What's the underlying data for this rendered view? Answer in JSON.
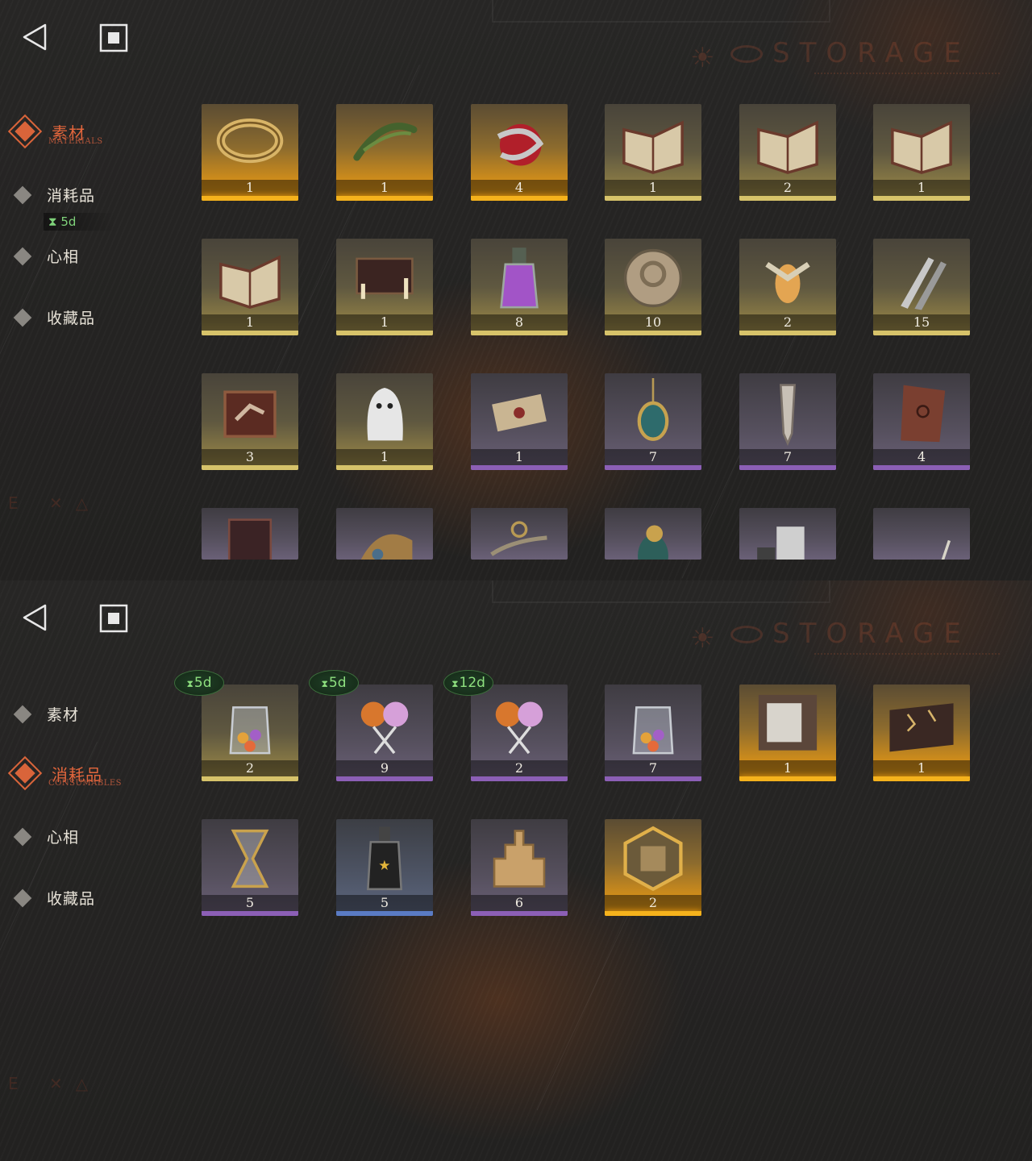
{
  "screens": [
    {
      "header": {
        "back_icon": "back-triangle-icon",
        "home_icon": "home-square-icon",
        "storage_title": "STORAGE"
      },
      "sidebar": {
        "items": [
          {
            "label": "素材",
            "sub": "MATERIALS",
            "active": true
          },
          {
            "label": "消耗品",
            "sub": "",
            "active": false,
            "timer": "5d"
          },
          {
            "label": "心相",
            "sub": "",
            "active": false
          },
          {
            "label": "收藏品",
            "sub": "",
            "active": false
          }
        ]
      },
      "items": [
        {
          "name": "gold-ring",
          "count": "1",
          "rarity": "gold"
        },
        {
          "name": "laurel-wreath",
          "count": "1",
          "rarity": "gold"
        },
        {
          "name": "snake-apple",
          "count": "4",
          "rarity": "gold"
        },
        {
          "name": "red-rune-book",
          "count": "1",
          "rarity": "yellow"
        },
        {
          "name": "green-rune-book",
          "count": "2",
          "rarity": "yellow"
        },
        {
          "name": "blue-rune-book",
          "count": "1",
          "rarity": "yellow"
        },
        {
          "name": "gold-rune-book",
          "count": "1",
          "rarity": "yellow"
        },
        {
          "name": "ouija-board",
          "count": "1",
          "rarity": "yellow"
        },
        {
          "name": "purple-potion",
          "count": "8",
          "rarity": "yellow"
        },
        {
          "name": "brass-medallion",
          "count": "10",
          "rarity": "yellow"
        },
        {
          "name": "firefly-bulb",
          "count": "2",
          "rarity": "yellow"
        },
        {
          "name": "silver-bullets",
          "count": "15",
          "rarity": "yellow"
        },
        {
          "name": "hand-in-box",
          "count": "3",
          "rarity": "yellow"
        },
        {
          "name": "ghost-sheet",
          "count": "1",
          "rarity": "yellow"
        },
        {
          "name": "scroll-bundle",
          "count": "1",
          "rarity": "purple"
        },
        {
          "name": "beetle-amulet",
          "count": "7",
          "rarity": "purple"
        },
        {
          "name": "crystal-pendulum",
          "count": "7",
          "rarity": "purple"
        },
        {
          "name": "stone-tablet",
          "count": "4",
          "rarity": "purple"
        },
        {
          "name": "coffin-case",
          "count": "",
          "rarity": "purple"
        },
        {
          "name": "brass-device",
          "count": "",
          "rarity": "purple"
        },
        {
          "name": "winged-key",
          "count": "",
          "rarity": "purple"
        },
        {
          "name": "green-bird",
          "count": "",
          "rarity": "purple"
        },
        {
          "name": "silver-ingot",
          "count": "",
          "rarity": "purple"
        },
        {
          "name": "animal-skeleton",
          "count": "",
          "rarity": "purple"
        }
      ]
    },
    {
      "header": {
        "back_icon": "back-triangle-icon",
        "home_icon": "home-square-icon",
        "storage_title": "STORAGE"
      },
      "sidebar": {
        "items": [
          {
            "label": "素材",
            "sub": "",
            "active": false
          },
          {
            "label": "消耗品",
            "sub": "CONSUMABLES",
            "active": true
          },
          {
            "label": "心相",
            "sub": "",
            "active": false
          },
          {
            "label": "收藏品",
            "sub": "",
            "active": false
          }
        ]
      },
      "items": [
        {
          "name": "candy-jar",
          "count": "2",
          "rarity": "yellow",
          "timer": "5d"
        },
        {
          "name": "lollipops",
          "count": "9",
          "rarity": "purple",
          "timer": "5d"
        },
        {
          "name": "lollipops-b",
          "count": "2",
          "rarity": "purple",
          "timer": "12d"
        },
        {
          "name": "candy-jar-b",
          "count": "7",
          "rarity": "purple",
          "timer": ""
        },
        {
          "name": "photo-box",
          "count": "1",
          "rarity": "gold",
          "timer": ""
        },
        {
          "name": "rune-chest",
          "count": "1",
          "rarity": "gold",
          "timer": ""
        },
        {
          "name": "hourglass",
          "count": "5",
          "rarity": "purple",
          "timer": ""
        },
        {
          "name": "bottle-stars",
          "count": "5",
          "rarity": "blue",
          "timer": ""
        },
        {
          "name": "sand-castle",
          "count": "6",
          "rarity": "purple",
          "timer": ""
        },
        {
          "name": "puzzle-medal",
          "count": "2",
          "rarity": "gold",
          "timer": ""
        }
      ]
    }
  ]
}
